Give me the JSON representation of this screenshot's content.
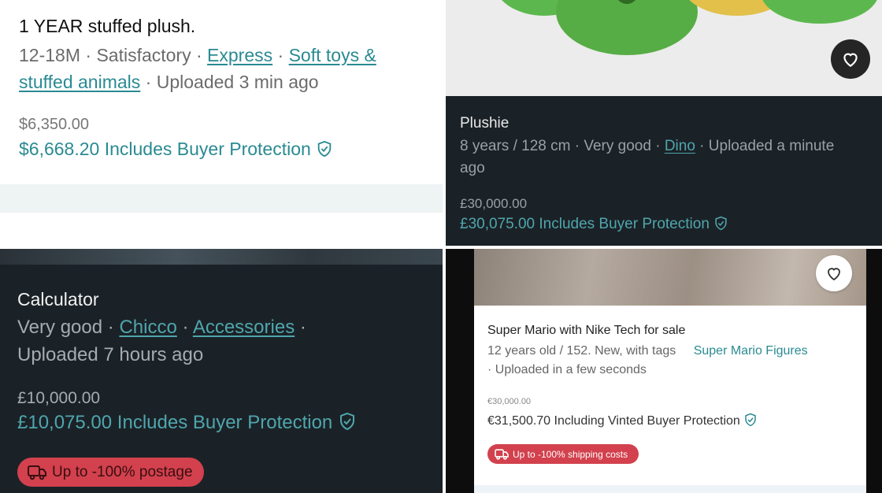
{
  "listings": [
    {
      "title": "1 YEAR stuffed plush.",
      "size": "12-18M",
      "condition": "Satisfactory",
      "link1": "Express",
      "link2": "Soft toys & stuffed animals",
      "uploaded": "Uploaded 3 min ago",
      "price": "$6,350.00",
      "total": "$6,668.20",
      "protection": "Includes Buyer Protection"
    },
    {
      "title": "Plushie",
      "size": "8 years / 128 cm",
      "condition": "Very good",
      "link1": "Dino",
      "uploaded": "Uploaded a minute ago",
      "price": "£30,000.00",
      "total": "£30,075.00",
      "protection": "Includes Buyer Protection"
    },
    {
      "title": "Calculator",
      "condition": "Very good",
      "link1": "Chicco",
      "link2": "Accessories",
      "uploaded": "Uploaded 7 hours ago",
      "price": "£10,000.00",
      "total": "£10,075.00",
      "protection": "Includes Buyer Protection",
      "badge": "Up to -100% postage"
    },
    {
      "title": "Super Mario with Nike Tech for sale",
      "meta": "12 years old / 152. New, with tags",
      "category": "Super Mario Figures",
      "uploaded": "· Uploaded in a few seconds",
      "price": "€30,000.00",
      "total": "€31,500.70",
      "protection": "Including Vinted Buyer Protection",
      "badge": "Up to -100% shipping costs"
    }
  ],
  "separator": "·",
  "colors": {
    "accent": "#2a8a92",
    "dark_bg": "#1b2227",
    "badge": "#d2414d"
  },
  "icons": [
    "shield-check-icon",
    "heart-icon",
    "truck-icon"
  ]
}
